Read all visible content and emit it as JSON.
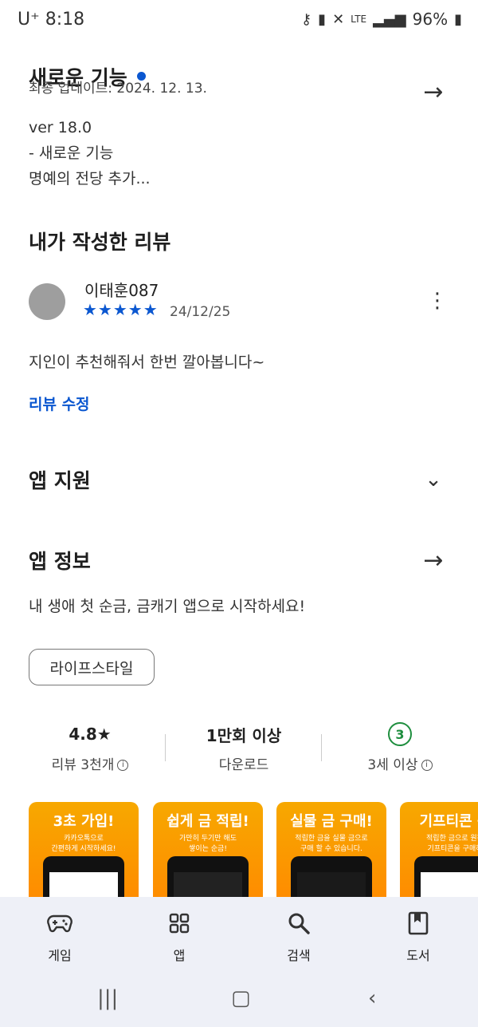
{
  "status_bar": {
    "carrier": "U⁺ 8:18",
    "network": "LTE",
    "battery": "96%"
  },
  "whats_new": {
    "title": "새로운 기능",
    "updated": "최종 업데이트: 2024. 12. 13.",
    "lines": [
      "ver 18.0",
      "- 새로운 기능",
      "명예의 전당 추가..."
    ]
  },
  "my_review": {
    "title": "내가 작성한 리뷰",
    "reviewer": "이태훈087",
    "stars": "★★★★★",
    "rating": 5,
    "date": "24/12/25",
    "text": "지인이 추천해줘서 한번 깔아봅니다~",
    "edit_link": "리뷰 수정"
  },
  "app_support": {
    "title": "앱 지원"
  },
  "app_info": {
    "title": "앱 정보",
    "description": "내 생애 첫 순금, 금캐기 앱으로 시작하세요!",
    "category_chip": "라이프스타일"
  },
  "stats": {
    "rating_value": "4.8★",
    "rating_label": "리뷰 3천개",
    "downloads_value": "1만회 이상",
    "downloads_label": "다운로드",
    "age_badge": "3",
    "age_label": "3세 이상"
  },
  "screenshots": [
    {
      "title": "3초 가입!",
      "sub1": "카카오톡으로",
      "sub2": "간편하게 시작하세요!"
    },
    {
      "title": "쉽게 금 적립!",
      "sub1": "가만히 두기만 해도",
      "sub2": "쌓이는 순금!"
    },
    {
      "title": "실물 금 구매!",
      "sub1": "적립한 금을 실물 금으로",
      "sub2": "구매 할 수 있습니다."
    },
    {
      "title": "기프티콘 구",
      "sub1": "적립한 금으로 원하",
      "sub2": "기프티콘을 구매하"
    }
  ],
  "bottom_nav": {
    "games": "게임",
    "apps": "앱",
    "search": "검색",
    "books": "도서"
  },
  "colors": {
    "accent": "#0b57d0",
    "age_green": "#1e8e3e",
    "nav_bg": "#eef0f7"
  }
}
